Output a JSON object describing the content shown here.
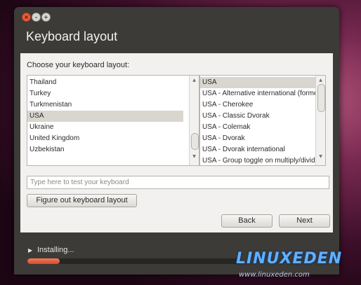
{
  "window": {
    "title": "Keyboard layout",
    "controls": {
      "close": "×",
      "minimize": "–",
      "maximize": "+"
    }
  },
  "content": {
    "prompt": "Choose your keyboard layout:",
    "layouts": [
      "Thailand",
      "Turkey",
      "Turkmenistan",
      "USA",
      "Ukraine",
      "United Kingdom",
      "Uzbekistan"
    ],
    "layouts_selected": "USA",
    "variants": [
      "USA",
      "USA - Alternative international (former us_intl)",
      "USA - Cherokee",
      "USA - Classic Dvorak",
      "USA - Colemak",
      "USA - Dvorak",
      "USA - Dvorak international",
      "USA - Group toggle on multiply/divide key"
    ],
    "variants_selected": "USA",
    "test_placeholder": "Type here to test your keyboard",
    "figure_out_label": "Figure out keyboard layout",
    "back_label": "Back",
    "next_label": "Next"
  },
  "status": {
    "label": "Installing...",
    "progress_fraction": 0.15
  },
  "watermark": {
    "logo": "LINUXEDEN",
    "url": "www.linuxeden.com"
  }
}
